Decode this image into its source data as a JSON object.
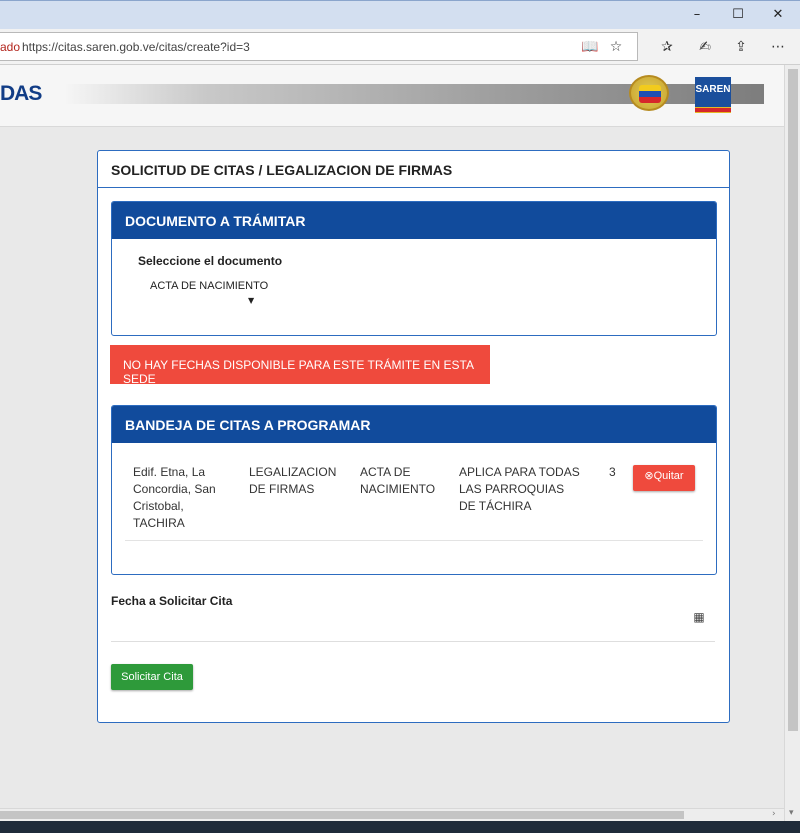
{
  "browser": {
    "url_prefix": "ado",
    "url": "https://citas.saren.gob.ve/citas/create?id=3",
    "window_buttons": [
      "–",
      "☐",
      "✕"
    ],
    "icons": [
      "reading-view-icon",
      "favorite-star-icon",
      "favorites-hub-icon",
      "web-note-icon",
      "share-icon",
      "more-icon"
    ]
  },
  "site_header": {
    "logo_text": "DAS",
    "saren_logo": "SAREN"
  },
  "card": {
    "title": "SOLICITUD DE CITAS / LEGALIZACION DE FIRMAS",
    "document_panel": {
      "heading": "DOCUMENTO A TRÁMITAR",
      "select_label": "Seleccione el documento",
      "selected_document": "ACTA DE NACIMIENTO"
    },
    "alert": "NO HAY FECHAS DISPONIBLE PARA ESTE TRÁMITE EN ESTA SEDE",
    "queue_panel": {
      "heading": "BANDEJA DE CITAS A PROGRAMAR",
      "rows": [
        {
          "sede": "Edif. Etna, La Concordia, San Cristobal, TACHIRA",
          "tramite": "LEGALIZACION DE FIRMAS",
          "documento": "ACTA DE NACIMIENTO",
          "aplica": "APLICA PARA TODAS LAS PARROQUIAS DE TÁCHIRA",
          "cantidad": "3",
          "remove_label": "Quitar"
        }
      ]
    },
    "date_label": "Fecha a Solicitar Cita",
    "submit_label": "Solicitar Cita"
  },
  "colors": {
    "panel_header": "#114b9c",
    "alert": "#ef4a3d",
    "submit": "#2e9a3a",
    "border": "#2d6cc0"
  }
}
